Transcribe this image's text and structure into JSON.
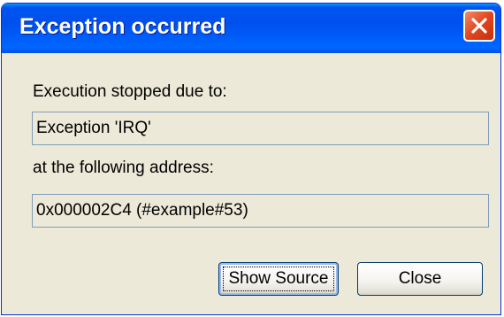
{
  "window": {
    "title": "Exception occurred",
    "close_icon": "close-icon"
  },
  "body": {
    "reason_label": "Execution stopped due to:",
    "reason_value": "Exception 'IRQ'",
    "address_label": "at the following address:",
    "address_value": "0x000002C4 (#example#53)"
  },
  "buttons": {
    "show_source": "Show Source",
    "close": "Close"
  },
  "colors": {
    "titlebar": "#0054e3",
    "close_button": "#e0461f",
    "dialog_face": "#ece9d8",
    "field_border": "#7f9db9",
    "button_border": "#003c74"
  }
}
